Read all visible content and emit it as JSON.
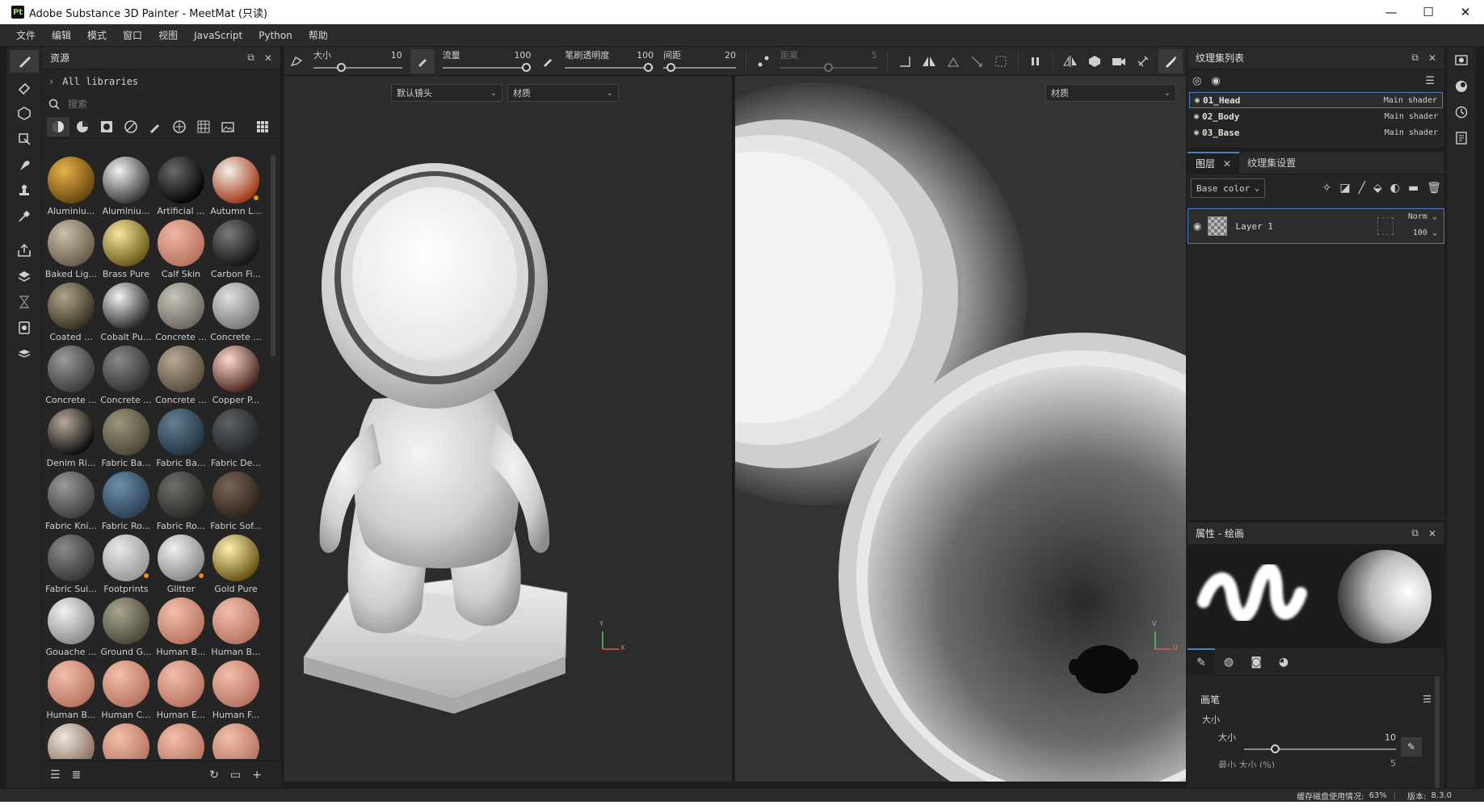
{
  "window": {
    "app_icon": "Pt",
    "title": "Adobe Substance 3D Painter - MeetMat (只读)",
    "controls": [
      "—",
      "☐",
      "✕"
    ]
  },
  "menu": [
    "文件",
    "编辑",
    "模式",
    "窗口",
    "视图",
    "JavaScript",
    "Python",
    "帮助"
  ],
  "tools": [
    {
      "icon": "paintbrush-icon",
      "active": true
    },
    {
      "icon": "eraser-icon"
    },
    {
      "icon": "projection-icon"
    },
    {
      "icon": "polygon-fill-icon"
    },
    {
      "icon": "smudge-icon"
    },
    {
      "icon": "clone-stamp-icon"
    },
    {
      "icon": "color-picker-icon"
    },
    {
      "icon": "export-icon"
    },
    {
      "icon": "bake-icon"
    },
    {
      "icon": "hourglass-icon"
    },
    {
      "icon": "capture-icon"
    },
    {
      "icon": "camera-icon"
    }
  ],
  "assets": {
    "title": "资源",
    "library": "All libraries",
    "search_placeholder": "搜索",
    "items": [
      {
        "label": "Aluminiu...",
        "color_a": "#e6b24a",
        "color_b": "#6a4710",
        "badge": false
      },
      {
        "label": "Aluminiu...",
        "color_a": "#f2f2f2",
        "color_b": "#3a3a3a",
        "badge": false
      },
      {
        "label": "Artificial ...",
        "color_a": "#6a6a6a",
        "color_b": "#050505",
        "badge": false
      },
      {
        "label": "Autumn L...",
        "color_a": "#f4f0ea",
        "color_b": "#a23b1a",
        "badge": true
      },
      {
        "label": "Baked Lig...",
        "color_a": "#cbbfa9",
        "color_b": "#6a5f4e",
        "badge": false
      },
      {
        "label": "Brass Pure",
        "color_a": "#f6e6a0",
        "color_b": "#6d5c18",
        "badge": false
      },
      {
        "label": "Calf Skin",
        "color_a": "#f0b7a2",
        "color_b": "#b77360",
        "badge": false
      },
      {
        "label": "Carbon Fi...",
        "color_a": "#7a7a7a",
        "color_b": "#151515",
        "badge": false
      },
      {
        "label": "Coated ...",
        "color_a": "#b0a68a",
        "color_b": "#383323",
        "badge": false
      },
      {
        "label": "Cobalt Pu...",
        "color_a": "#f2f2f2",
        "color_b": "#2c2c2c",
        "badge": false
      },
      {
        "label": "Concrete ...",
        "color_a": "#c9c3b8",
        "color_b": "#6e6a63",
        "badge": false
      },
      {
        "label": "Concrete ...",
        "color_a": "#e0e0e0",
        "color_b": "#7a7a7a",
        "badge": false
      },
      {
        "label": "Concrete ...",
        "color_a": "#9a9a9a",
        "color_b": "#3c3c3c",
        "badge": false
      },
      {
        "label": "Concrete ...",
        "color_a": "#8a8a8a",
        "color_b": "#333333",
        "badge": false
      },
      {
        "label": "Concrete ...",
        "color_a": "#b8a993",
        "color_b": "#5a4e3f",
        "badge": false
      },
      {
        "label": "Copper P...",
        "color_a": "#ffd7c9",
        "color_b": "#4c2a22",
        "badge": false
      },
      {
        "label": "Denim Ri...",
        "color_a": "#b8a89a",
        "color_b": "#0e0e0e",
        "badge": false
      },
      {
        "label": "Fabric Ba...",
        "color_a": "#9c967c",
        "color_b": "#4d4937",
        "badge": false
      },
      {
        "label": "Fabric Ba...",
        "color_a": "#647f92",
        "color_b": "#253643",
        "badge": false
      },
      {
        "label": "Fabric De...",
        "color_a": "#5c6166",
        "color_b": "#22262a",
        "badge": false
      },
      {
        "label": "Fabric Kni...",
        "color_a": "#9a9a9a",
        "color_b": "#404040",
        "badge": false
      },
      {
        "label": "Fabric Ro...",
        "color_a": "#6c8fac",
        "color_b": "#2c4154",
        "badge": false
      },
      {
        "label": "Fabric Ro...",
        "color_a": "#6f6f6a",
        "color_b": "#2c2c29",
        "badge": false
      },
      {
        "label": "Fabric Sof...",
        "color_a": "#7a6558",
        "color_b": "#2f241d",
        "badge": false
      },
      {
        "label": "Fabric Sui...",
        "color_a": "#8a8a8a",
        "color_b": "#393939",
        "badge": false
      },
      {
        "label": "Footprints",
        "color_a": "#e8e8e8",
        "color_b": "#9a9a9a",
        "badge": true
      },
      {
        "label": "Glitter",
        "color_a": "#f0f0f0",
        "color_b": "#8a8a8a",
        "badge": true
      },
      {
        "label": "Gold Pure",
        "color_a": "#fff1b0",
        "color_b": "#6a5414",
        "badge": false
      },
      {
        "label": "Gouache ...",
        "color_a": "#f2f2f2",
        "color_b": "#8d8d8d",
        "badge": false
      },
      {
        "label": "Ground G...",
        "color_a": "#a9a58e",
        "color_b": "#4d4a3b",
        "badge": false
      },
      {
        "label": "Human B...",
        "color_a": "#f3bfa9",
        "color_b": "#b97663",
        "badge": false
      },
      {
        "label": "Human B...",
        "color_a": "#f3bfa9",
        "color_b": "#b97663",
        "badge": false
      },
      {
        "label": "Human B...",
        "color_a": "#f3bfa9",
        "color_b": "#b97663",
        "badge": false
      },
      {
        "label": "Human C...",
        "color_a": "#f3bfa9",
        "color_b": "#b97663",
        "badge": false
      },
      {
        "label": "Human E...",
        "color_a": "#f3bfa9",
        "color_b": "#b97663",
        "badge": false
      },
      {
        "label": "Human F...",
        "color_a": "#f3bfa9",
        "color_b": "#b97663",
        "badge": false
      },
      {
        "label": "",
        "color_a": "#eee6dd",
        "color_b": "#8c6f60",
        "badge": false
      },
      {
        "label": "",
        "color_a": "#f3bfa9",
        "color_b": "#b97663",
        "badge": false
      },
      {
        "label": "",
        "color_a": "#f3bfa9",
        "color_b": "#b97663",
        "badge": false
      },
      {
        "label": "",
        "color_a": "#f3bfa9",
        "color_b": "#b97663",
        "badge": false
      }
    ],
    "badge_color": "#f08a24"
  },
  "toolbar": {
    "size_label": "大小",
    "size_value": "10",
    "size_fraction": 0.3,
    "flow_label": "流量",
    "flow_value": "100",
    "flow_fraction": 1.0,
    "opacity_label": "笔刷透明度",
    "opacity_value": "100",
    "opacity_fraction": 1.0,
    "spacing_label": "间距",
    "spacing_value": "20",
    "spacing_fraction": 0.05,
    "distance_label": "距离",
    "distance_value": "5",
    "distance_fraction": 0.5
  },
  "viewport3d": {
    "camera_select": "默认镜头",
    "material_select": "材质",
    "axis_x": "X",
    "axis_y": "Y"
  },
  "viewport2d": {
    "material_select": "材质",
    "axis_u": "U",
    "axis_v": "V"
  },
  "texture_sets": {
    "title": "纹理集列表",
    "items": [
      {
        "name": "01_Head",
        "shader": "Main shader",
        "selected": true
      },
      {
        "name": "02_Body",
        "shader": "Main shader",
        "selected": false
      },
      {
        "name": "03_Base",
        "shader": "Main shader",
        "selected": false
      }
    ]
  },
  "layers": {
    "tab_layers": "图层",
    "tab_settings": "纹理集设置",
    "channel": "Base color",
    "layer_name": "Layer 1",
    "blend_mode": "Norm",
    "opacity": "100"
  },
  "properties": {
    "title": "属性 - 绘画",
    "section": "画笔",
    "group": "大小",
    "size_label": "大小",
    "size_value": "10",
    "size_fraction": 0.3,
    "cut_label": "最小 大小 (%)",
    "cut_value": "5"
  },
  "right_strip": [
    "display-settings-icon",
    "shader-settings-icon",
    "history-icon",
    "log-icon"
  ],
  "status": {
    "cache_label": "缓存磁盘使用情况:",
    "cache_value": "63%",
    "version_label": "版本:",
    "version_value": "8.3.0"
  }
}
